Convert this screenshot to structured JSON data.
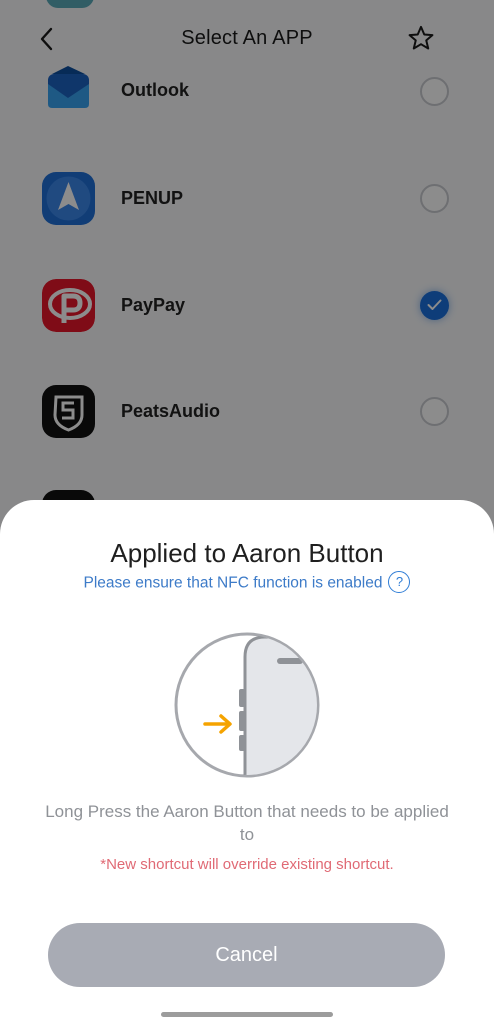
{
  "header": {
    "title": "Select An APP",
    "back_icon": "chevron-left-icon",
    "favorite_icon": "star-outline-icon"
  },
  "apps": [
    {
      "name": "Outlook",
      "selected": false,
      "icon": "outlook-icon"
    },
    {
      "name": "PENUP",
      "selected": false,
      "icon": "penup-icon"
    },
    {
      "name": "PayPay",
      "selected": true,
      "icon": "paypay-icon"
    },
    {
      "name": "PeatsAudio",
      "selected": false,
      "icon": "peatsaudio-icon"
    }
  ],
  "sheet": {
    "title": "Applied to Aaron Button",
    "nfc_notice": "Please ensure that NFC function is enabled",
    "help_icon_glyph": "?",
    "instruction": "Long Press the Aaron Button that needs to be applied to",
    "warning": "*New shortcut will override existing shortcut.",
    "cancel_label": "Cancel"
  },
  "colors": {
    "accent": "#1a6fdc",
    "link": "#3d7bc8",
    "warning": "#e06a75",
    "button_disabled": "#a8abb4",
    "arrow": "#f5a300"
  }
}
